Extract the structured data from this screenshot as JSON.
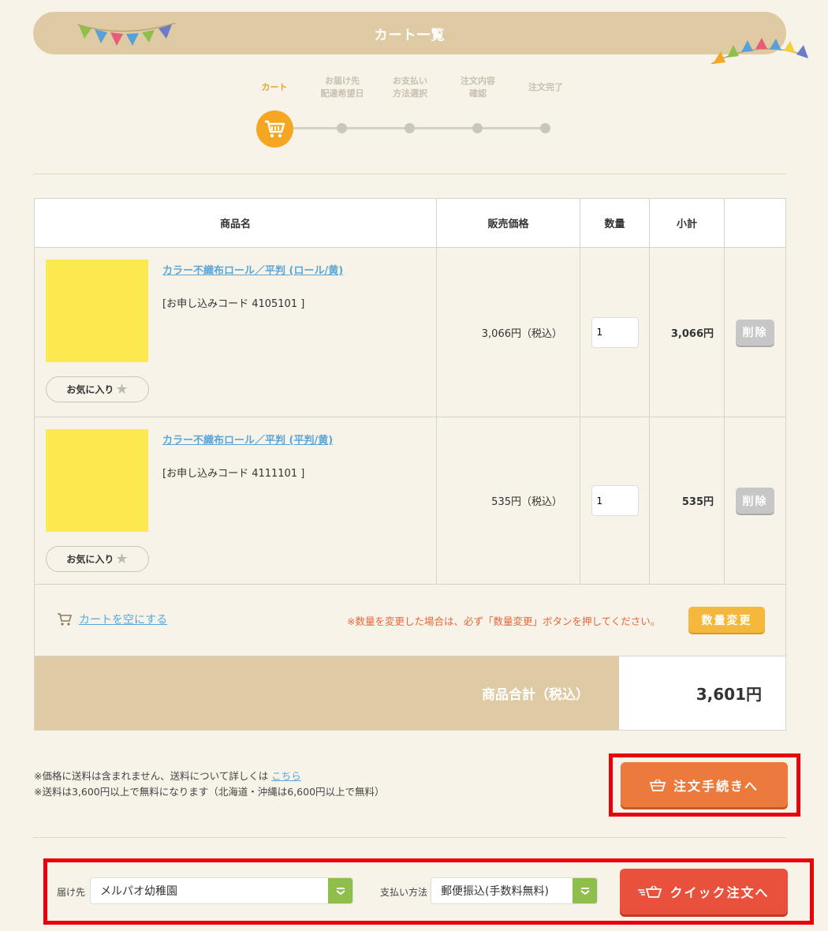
{
  "header": {
    "title": "カート一覧"
  },
  "steps": [
    {
      "label": "カート",
      "active": true
    },
    {
      "label": "お届け先\n配達希望日",
      "active": false
    },
    {
      "label": "お支払い\n方法選択",
      "active": false
    },
    {
      "label": "注文内容\n確認",
      "active": false
    },
    {
      "label": "注文完了",
      "active": false
    }
  ],
  "table": {
    "headers": {
      "name": "商品名",
      "price": "販売価格",
      "qty": "数量",
      "subtotal": "小計"
    },
    "fav_label": "お気に入り",
    "delete_label": "削除",
    "items": [
      {
        "name": "カラー不織布ロール／平判 (ロール/黄)",
        "code": "[お申し込みコード 4105101 ]",
        "price": "3,066円（税込）",
        "qty": "1",
        "subtotal": "3,066円",
        "color": "#fbe94f"
      },
      {
        "name": "カラー不織布ロール／平判 (平判/黄)",
        "code": "[お申し込みコード 4111101 ]",
        "price": "535円（税込）",
        "qty": "1",
        "subtotal": "535円",
        "color": "#fbe94f"
      }
    ]
  },
  "cart_actions": {
    "empty_cart": "カートを空にする",
    "notice": "※数量を変更した場合は、必ず「数量変更」ボタンを押してください。",
    "qty_change": "数量変更"
  },
  "total": {
    "label": "商品合計（税込）",
    "value": "3,601円"
  },
  "shipping": {
    "note1_prefix": "※価格に送料は含まれません、送料について詳しくは ",
    "note1_link": "こちら",
    "note2": "※送料は3,600円以上で無料になります（北海道・沖縄は6,600円以上で無料）"
  },
  "order_button": "注文手続きへ",
  "quick": {
    "dest_label": "届け先",
    "dest_value": "メルパオ幼稚園",
    "pay_label": "支払い方法",
    "pay_value": "郵便振込(手数料無料)",
    "button": "クイック注文へ"
  },
  "colors": {
    "accent": "#f5a623",
    "banner": "#dfcba3",
    "link": "#5ba6d8",
    "highlight": "#e8000b"
  }
}
